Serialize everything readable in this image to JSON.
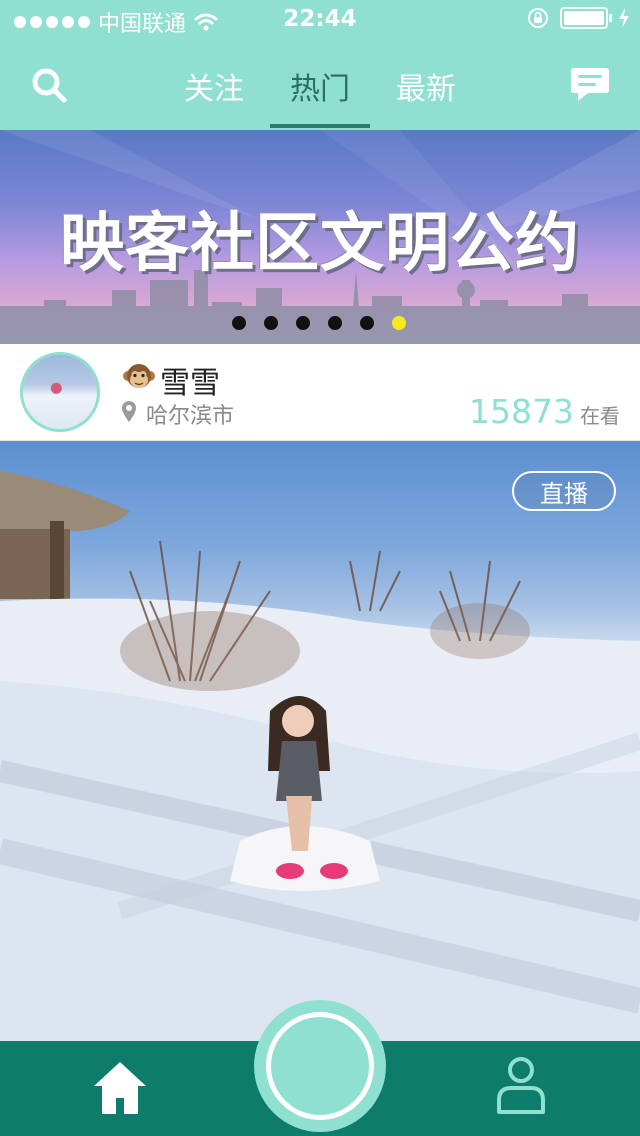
{
  "status_bar": {
    "carrier": "中国联通",
    "time": "22:44",
    "battery_level": 1.0
  },
  "nav": {
    "tabs": [
      {
        "label": "关注",
        "active": false
      },
      {
        "label": "热门",
        "active": true
      },
      {
        "label": "最新",
        "active": false
      }
    ]
  },
  "banner": {
    "title": "映客社区文明公约",
    "slide_count": 6,
    "active_slide": 6
  },
  "host": {
    "name": "雪雪",
    "city": "哈尔滨市",
    "viewer_count": "15873",
    "viewer_label": "在看"
  },
  "live": {
    "badge": "直播"
  },
  "colors": {
    "accent": "#8fe0d0",
    "tabbar": "#0d7c6a",
    "active_tab_text": "#2d6e63",
    "active_dot": "#f4ea1f"
  },
  "icons": {
    "search": "search-icon",
    "messages": "message-icon",
    "home": "home-icon",
    "profile": "person-icon",
    "location": "location-pin-icon"
  }
}
